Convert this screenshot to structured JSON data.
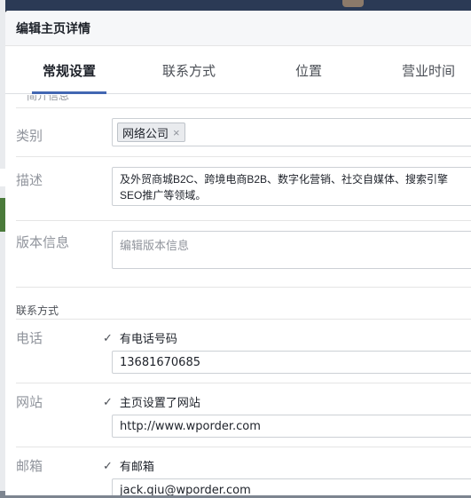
{
  "dialog": {
    "title": "编辑主页详情"
  },
  "tabs": [
    {
      "label": "常规设置",
      "active": true
    },
    {
      "label": "联系方式",
      "active": false
    },
    {
      "label": "位置",
      "active": false
    },
    {
      "label": "营业时间",
      "active": false
    }
  ],
  "general": {
    "cut_heading": "简介信息",
    "category": {
      "label": "类别",
      "tokens": [
        "网络公司"
      ],
      "remove_glyph": "×"
    },
    "description": {
      "label": "描述",
      "line1": "及外贸商城B2C、跨境电商B2B、数字化营销、社交自媒体、搜索引擎",
      "line2": "SEO推广等领域。"
    },
    "version": {
      "label": "版本信息",
      "placeholder": "编辑版本信息"
    }
  },
  "contact": {
    "section_title": "联系方式",
    "phone": {
      "label": "电话",
      "checkbox_label": "有电话号码",
      "checked": true,
      "value": "13681670685"
    },
    "website": {
      "label": "网站",
      "checkbox_label": "主页设置了网站",
      "checked": true,
      "value": "http://www.wporder.com"
    },
    "email": {
      "label": "邮箱",
      "checkbox_label": "有邮箱",
      "checked": true,
      "value": "jack.qiu@wporder.com"
    }
  },
  "icons": {
    "check": "check-icon",
    "remove": "close-icon"
  },
  "colors": {
    "accent": "#4267b2",
    "label_gray": "#90949c",
    "border": "#ccd0d5"
  }
}
